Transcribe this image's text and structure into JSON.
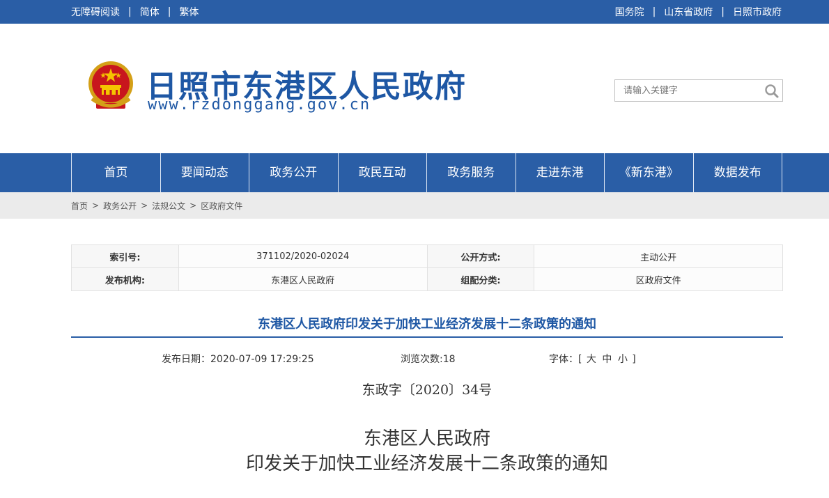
{
  "topbar": {
    "left_links": [
      "无障碍阅读",
      "简体",
      "繁体"
    ],
    "right_links": [
      "国务院",
      "山东省政府",
      "日照市政府"
    ],
    "separator": "|"
  },
  "header": {
    "emblem_icon": "national-emblem-icon",
    "title": "日照市东港区人民政府",
    "url": "www.rzdonggang.gov.cn",
    "search_placeholder": "请输入关键字",
    "search_icon": "search-icon"
  },
  "nav": {
    "items": [
      "首页",
      "要闻动态",
      "政务公开",
      "政民互动",
      "政务服务",
      "走进东港",
      "《新东港》",
      "数据发布"
    ]
  },
  "breadcrumb": {
    "items": [
      "首页",
      "政务公开",
      "法规公文",
      "区政府文件"
    ],
    "separator": ">"
  },
  "info_table": {
    "rows": [
      {
        "k1": "索引号:",
        "v1": "371102/2020-02024",
        "k2": "公开方式:",
        "v2": "主动公开"
      },
      {
        "k1": "发布机构:",
        "v1": "东港区人民政府",
        "k2": "组配分类:",
        "v2": "区政府文件"
      }
    ]
  },
  "article": {
    "title": "东港区人民政府印发关于加快工业经济发展十二条政策的通知",
    "publish_date": "发布日期：2020-07-09 17:29:25",
    "views": "浏览次数:18",
    "font_label": "字体：[",
    "font_large": "大",
    "font_medium": "中",
    "font_small": "小",
    "font_close": "]",
    "doc_number": "东政字〔2020〕34号",
    "body_title_line1": "东港区人民政府",
    "body_title_line2": "印发关于加快工业经济发展十二条政策的通知"
  },
  "colors": {
    "brand_blue": "#2a5ea6",
    "title_blue": "#1e57a4",
    "breadcrumb_bg": "#ebebeb"
  }
}
